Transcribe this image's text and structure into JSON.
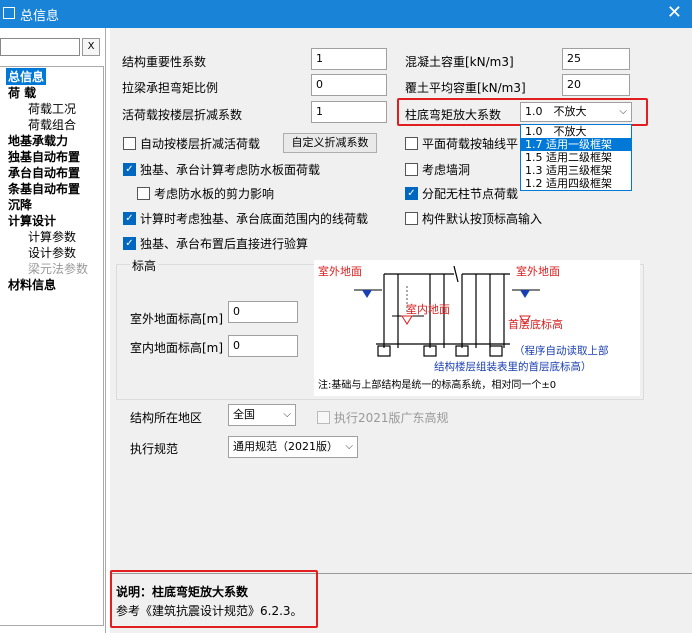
{
  "window": {
    "title": "总信息",
    "close": "✕"
  },
  "left": {
    "search_value": "",
    "clear_label": "X",
    "tree": [
      "总信息",
      "荷 载",
      "荷载工况",
      "荷载组合",
      "地基承载力",
      "独基自动布置",
      "承台自动布置",
      "条基自动布置",
      "沉降",
      "计算设计",
      "计算参数",
      "设计参数",
      "梁元法参数",
      "材料信息"
    ]
  },
  "form": {
    "structure_importance_label": "结构重要性系数",
    "structure_importance_value": "1",
    "tie_beam_moment_label": "拉梁承担弯矩比例",
    "tie_beam_moment_value": "0",
    "live_load_reduction_label": "活荷载按楼层折减系数",
    "live_load_reduction_value": "1",
    "concrete_density_label": "混凝土容重[kN/m3]",
    "concrete_density_value": "25",
    "soil_density_label": "覆土平均容重[kN/m3]",
    "soil_density_value": "20",
    "column_moment_label": "柱底弯矩放大系数",
    "column_moment_value": "1.0　不放大",
    "column_moment_options": [
      "1.0　不放大",
      "1.7 适用一级框架",
      "1.5 适用二级框架",
      "1.3 适用三级框架",
      "1.2 适用四级框架"
    ],
    "auto_reduction_label": "自动按楼层折减活荷载",
    "custom_reduction_btn": "自定义折减系数",
    "plane_load_label": "平面荷载按轴线平",
    "waterproof_label": "独基、承台计算考虑防水板面荷载",
    "wall_label": "考虑墙洞",
    "shear_label": "考虑防水板的剪力影响",
    "distribute_label": "分配无柱节点荷载",
    "line_load_label": "计算时考虑独基、承台底面范围内的线荷载",
    "default_elev_label": "构件默认按顶标高输入",
    "check_label": "独基、承台布置后直接进行验算",
    "elevation_group": "标高",
    "outdoor_elev_label": "室外地面标高[m]",
    "outdoor_elev_value": "0",
    "indoor_elev_label": "室内地面标高[m]",
    "indoor_elev_value": "0",
    "region_label": "结构所在地区",
    "region_value": "全国",
    "guangdong_label": "执行2021版广东高规",
    "code_label": "执行规范",
    "code_value": "通用规范（2021版）"
  },
  "diagram": {
    "outdoor_left": "室外地面",
    "outdoor_right": "室外地面",
    "indoor": "室内地面",
    "first_floor": "首层底标高",
    "auto_read_1": "（程序自动读取上部",
    "auto_read_2": "结构楼层组装表里的首层底标高）",
    "note": "注:基础与上部结构是统一的标高系统，相对同一个±0"
  },
  "description": {
    "title": "说明：柱底弯矩放大系数",
    "text": "参考《建筑抗震设计规范》6.2.3。"
  },
  "colors": {
    "accent": "#0078d7",
    "highlight": "#e21f1f",
    "diagram_red": "#d62020",
    "diagram_blue": "#1a3fb0"
  }
}
